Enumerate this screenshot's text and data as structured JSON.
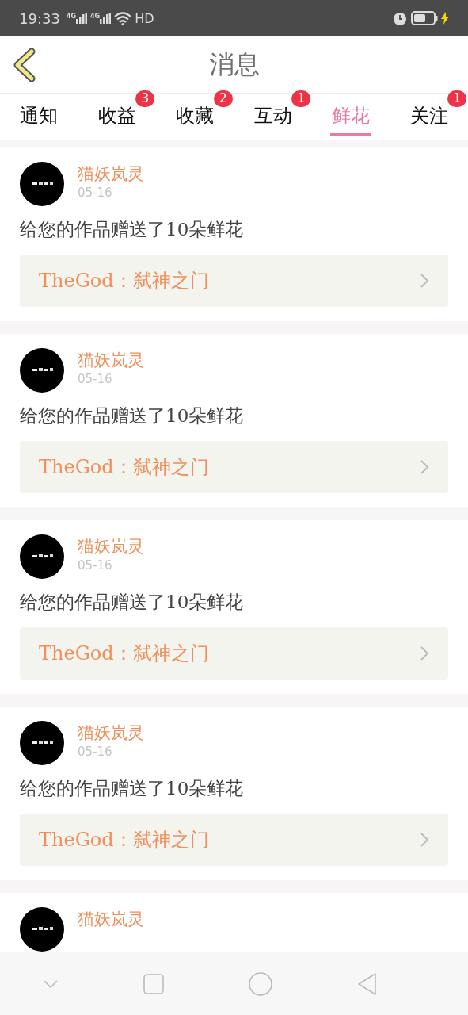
{
  "status_bar": {
    "time": "19:33",
    "network_labels": [
      "4G",
      "4G"
    ],
    "hd": "HD"
  },
  "header": {
    "title": "消息"
  },
  "tabs": [
    {
      "label": "通知",
      "selected": false
    },
    {
      "label": "收益",
      "selected": false,
      "badge": "3"
    },
    {
      "label": "收藏",
      "selected": false,
      "badge": "2"
    },
    {
      "label": "互动",
      "selected": false,
      "badge": "1"
    },
    {
      "label": "鲜花",
      "selected": true
    },
    {
      "label": "关注",
      "selected": false,
      "badge": "1"
    }
  ],
  "messages": [
    {
      "sender": "猫妖岚灵",
      "date": "05-16",
      "text": "给您的作品赠送了10朵鲜花",
      "work": "TheGod：弑神之门"
    },
    {
      "sender": "猫妖岚灵",
      "date": "05-16",
      "text": "给您的作品赠送了10朵鲜花",
      "work": "TheGod：弑神之门"
    },
    {
      "sender": "猫妖岚灵",
      "date": "05-16",
      "text": "给您的作品赠送了10朵鲜花",
      "work": "TheGod：弑神之门"
    },
    {
      "sender": "猫妖岚灵",
      "date": "05-16",
      "text": "给您的作品赠送了10朵鲜花",
      "work": "TheGod：弑神之门"
    },
    {
      "sender": "猫妖岚灵"
    }
  ]
}
